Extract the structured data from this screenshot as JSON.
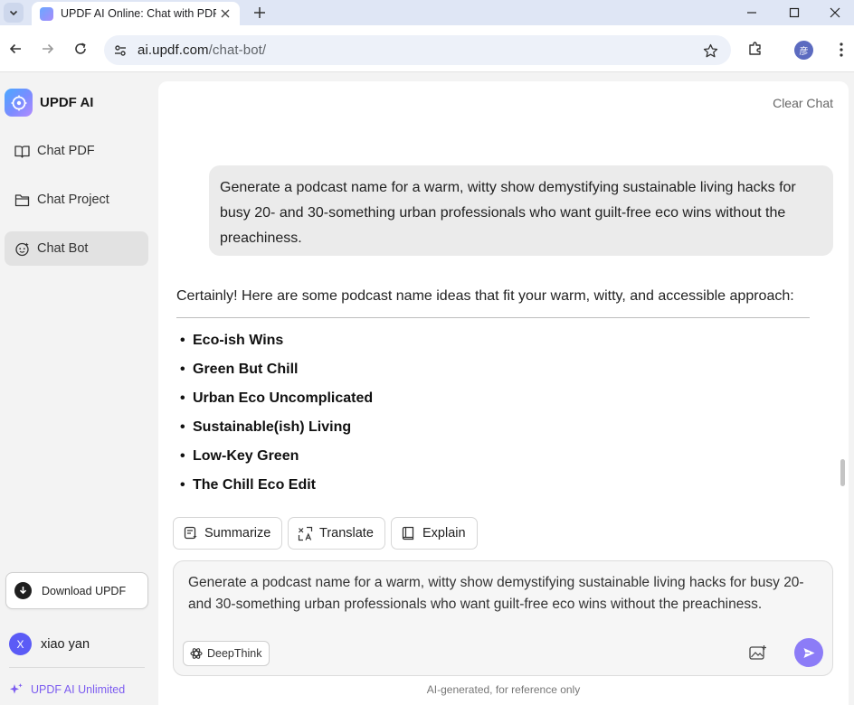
{
  "browser": {
    "tab_title": "UPDF AI Online: Chat with PDF",
    "url_host": "ai.updf.com",
    "url_path": "/chat-bot/",
    "profile_initial": "彦"
  },
  "sidebar": {
    "brand": "UPDF AI",
    "items": [
      {
        "label": "Chat PDF",
        "icon": "book-icon",
        "active": false
      },
      {
        "label": "Chat Project",
        "icon": "folder-icon",
        "active": false
      },
      {
        "label": "Chat Bot",
        "icon": "bot-icon",
        "active": true
      }
    ],
    "download_label": "Download UPDF",
    "user": {
      "initial": "X",
      "name": "xiao yan"
    },
    "unlimited_label": "UPDF AI Unlimited"
  },
  "main": {
    "clear_chat": "Clear Chat",
    "user_message": "Generate a podcast name for a warm, witty show demystifying sustainable living hacks for busy 20- and 30-something urban professionals who want guilt-free eco wins without the preachiness.",
    "answer_intro": "Certainly! Here are some podcast name ideas that fit your warm, witty, and accessible approach:",
    "answer_items": [
      "Eco-ish Wins",
      "Green But Chill",
      "Urban Eco Uncomplicated",
      "Sustainable(ish) Living",
      "Low-Key Green",
      "The Chill Eco Edit"
    ],
    "actions": [
      {
        "label": "Summarize",
        "icon": "summarize-icon"
      },
      {
        "label": "Translate",
        "icon": "translate-icon"
      },
      {
        "label": "Explain",
        "icon": "book-open-icon"
      }
    ],
    "composer_text": "Generate a podcast name for a warm, witty show demystifying sustainable living hacks for busy 20- and 30-something urban professionals who want guilt-free eco wins without the preachiness.",
    "deepthink_label": "DeepThink",
    "disclaimer": "AI-generated, for reference only"
  },
  "colors": {
    "accent": "#8c7cf7",
    "unlimited": "#7c5cf0",
    "active_nav": "#e2e2e2"
  }
}
